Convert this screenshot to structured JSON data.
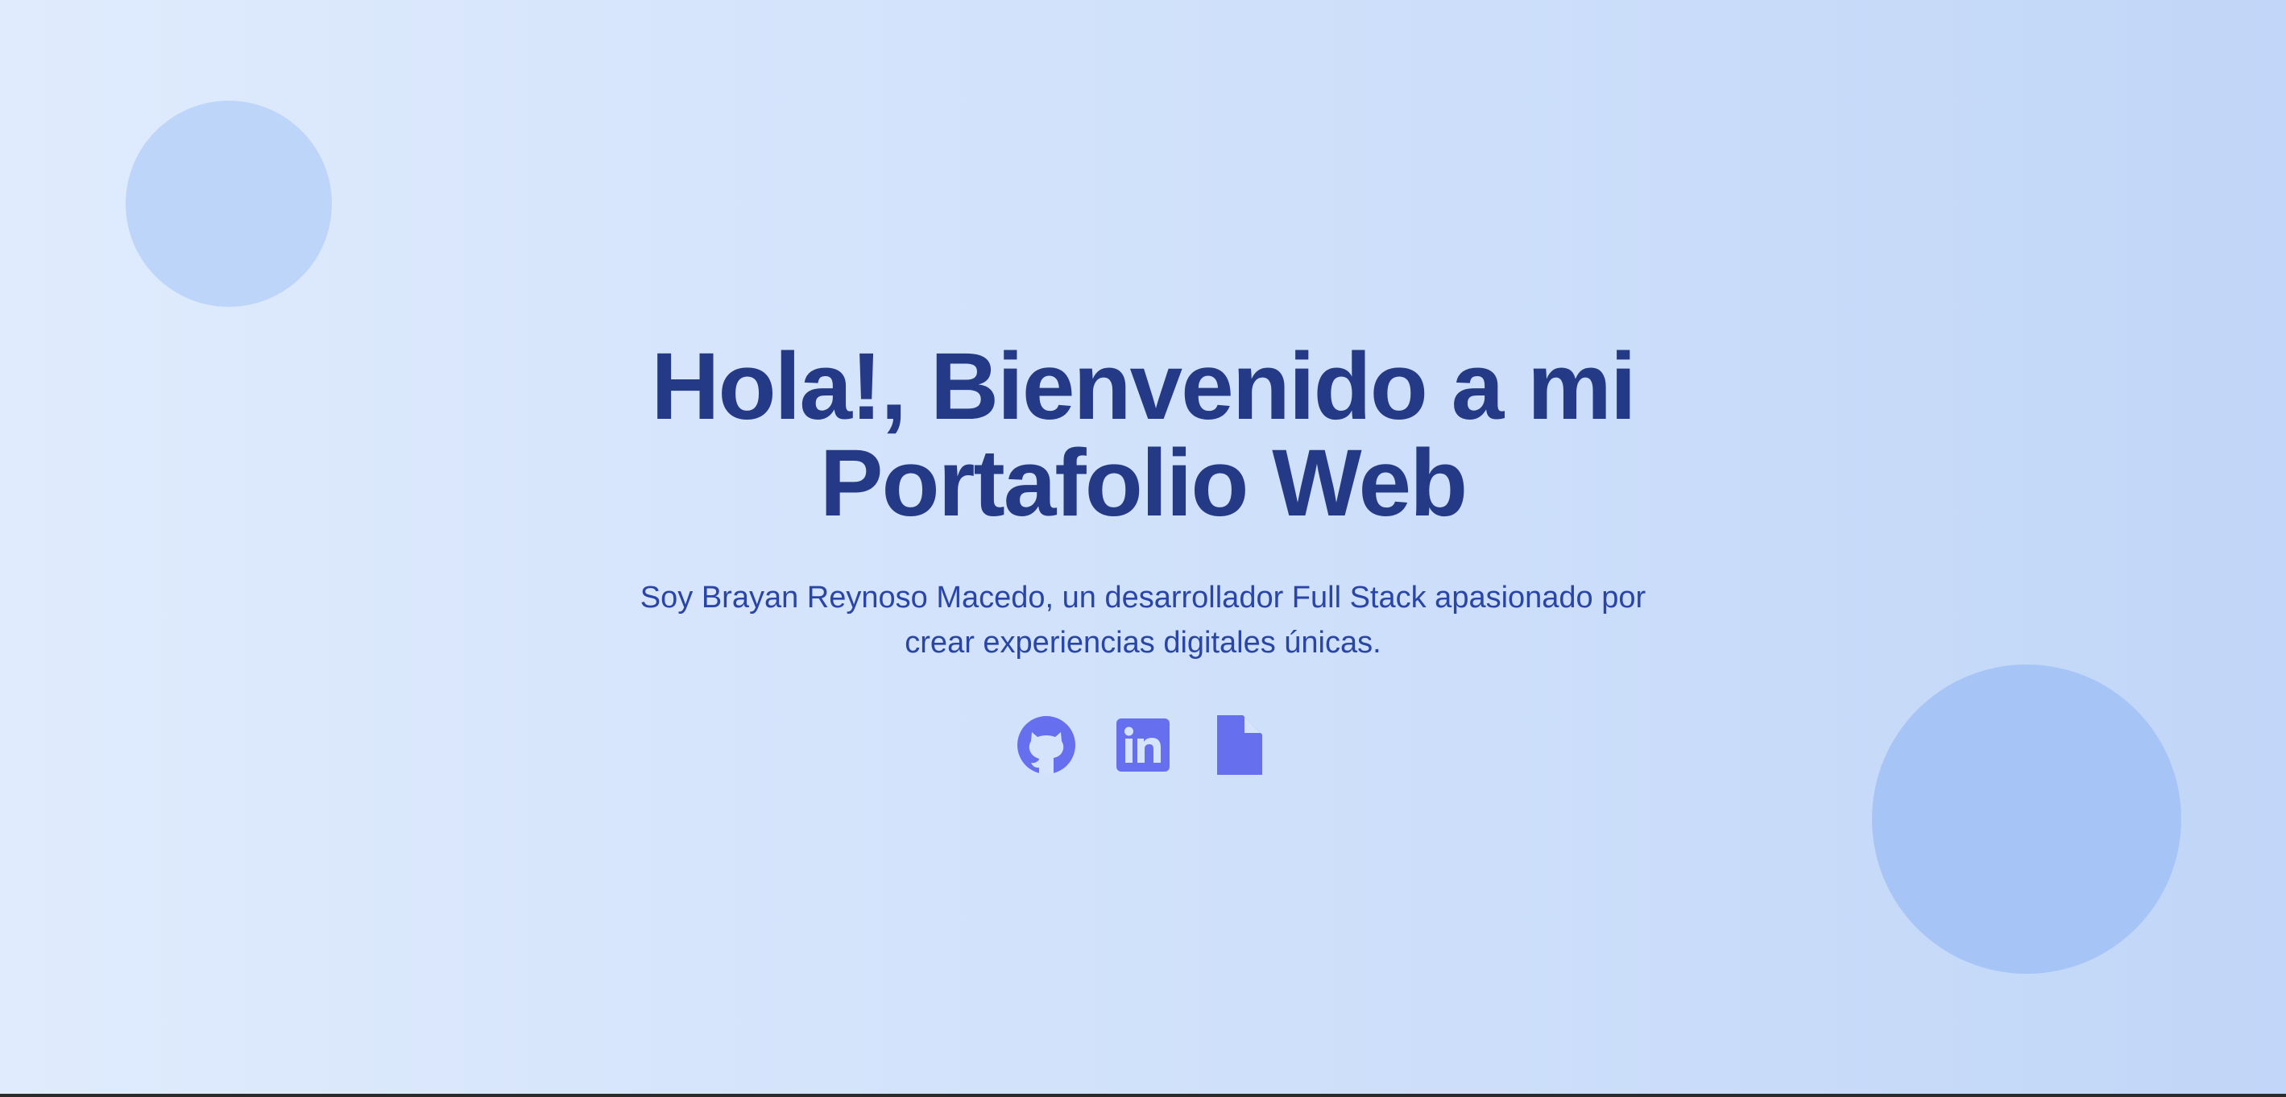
{
  "hero": {
    "title": "Hola!, Bienvenido a mi Portafolio Web",
    "subtitle": "Soy Brayan Reynoso Macedo, un desarrollador Full Stack apasionado por crear experiencias digitales únicas."
  },
  "socials": [
    {
      "icon": "github-icon"
    },
    {
      "icon": "linkedin-icon"
    },
    {
      "icon": "document-icon"
    }
  ],
  "colors": {
    "title": "#243a86",
    "subtitle": "#2a45a8",
    "icon": "#6670ef",
    "bubble_left": "#bdd5f9",
    "bubble_right": "#a6c5f6",
    "background_start": "#e0ebfd",
    "background_end": "#c1d6f8"
  }
}
